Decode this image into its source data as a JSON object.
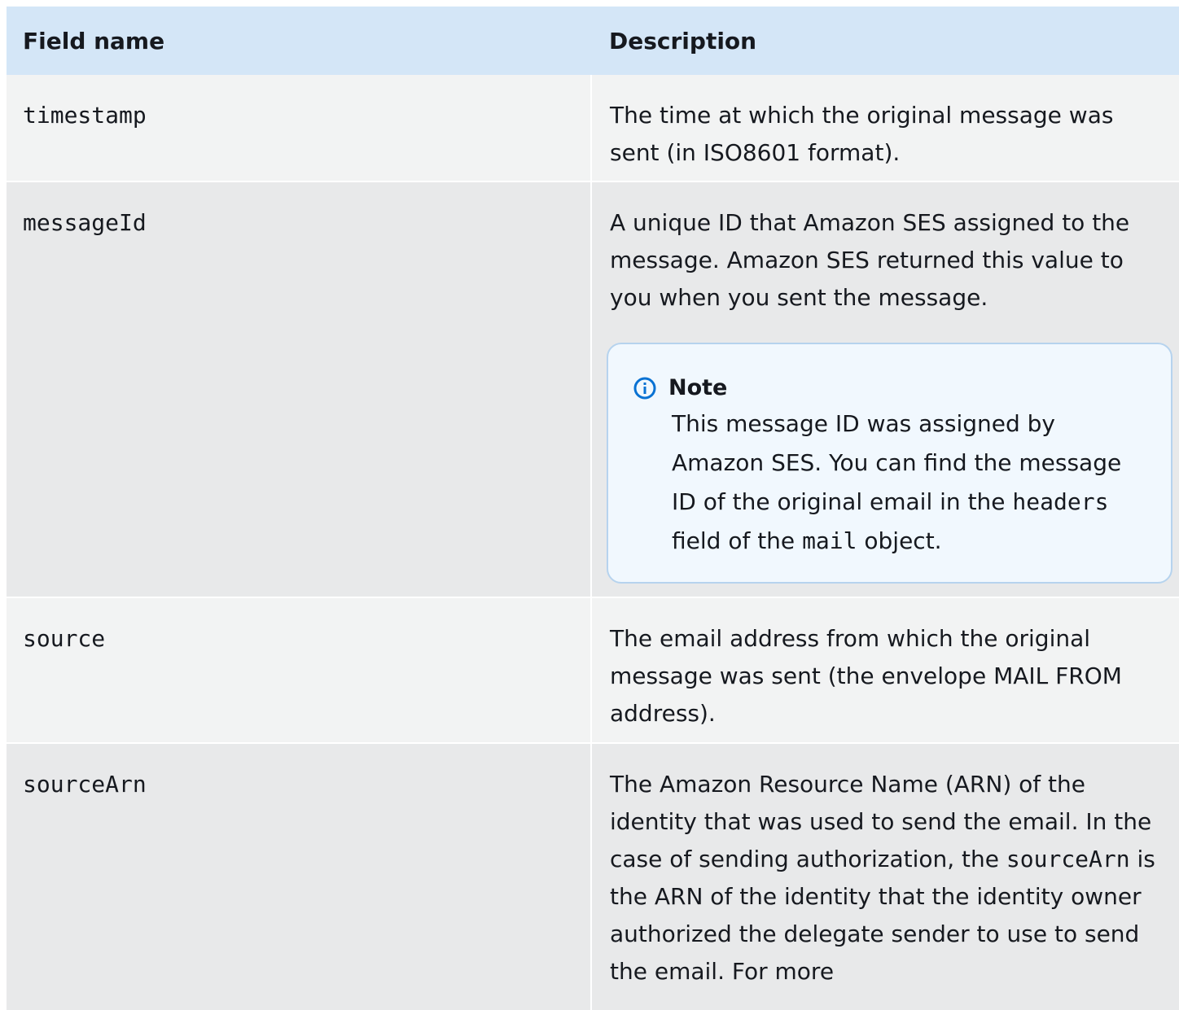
{
  "table": {
    "headers": [
      "Field name",
      "Description"
    ],
    "rows": [
      {
        "field": "timestamp",
        "description": "The time at which the original message was sent (in ISO8601 format)."
      },
      {
        "field": "messageId",
        "description": "A unique ID that Amazon SES assigned to the message. Amazon SES returned this value to you when you sent the message.",
        "note": {
          "title": "Note",
          "icon": "info-icon",
          "text_1": "This message ID was assigned by Amazon SES. You can find the message ID of the original email in the ",
          "code_1": "headers",
          "text_2": " field of the ",
          "code_2": "mail",
          "text_3": " object."
        }
      },
      {
        "field": "source",
        "description": "The email address from which the original message was sent (the envelope MAIL FROM address)."
      },
      {
        "field": "sourceArn",
        "description_1": "The Amazon Resource Name (ARN) of the identity that was used to send the email. In the case of sending authorization, the ",
        "code": "sourceArn",
        "description_2": " is the ARN of the identity that the identity owner authorized the delegate sender to use to send the email. For more"
      }
    ]
  },
  "colors": {
    "header_bg": "#d4e6f7",
    "row_light": "#f2f3f3",
    "row_dark": "#e8e9ea",
    "note_bg": "#f1f8fe",
    "note_border": "#b6d3ee",
    "info_icon": "#0972d3"
  }
}
